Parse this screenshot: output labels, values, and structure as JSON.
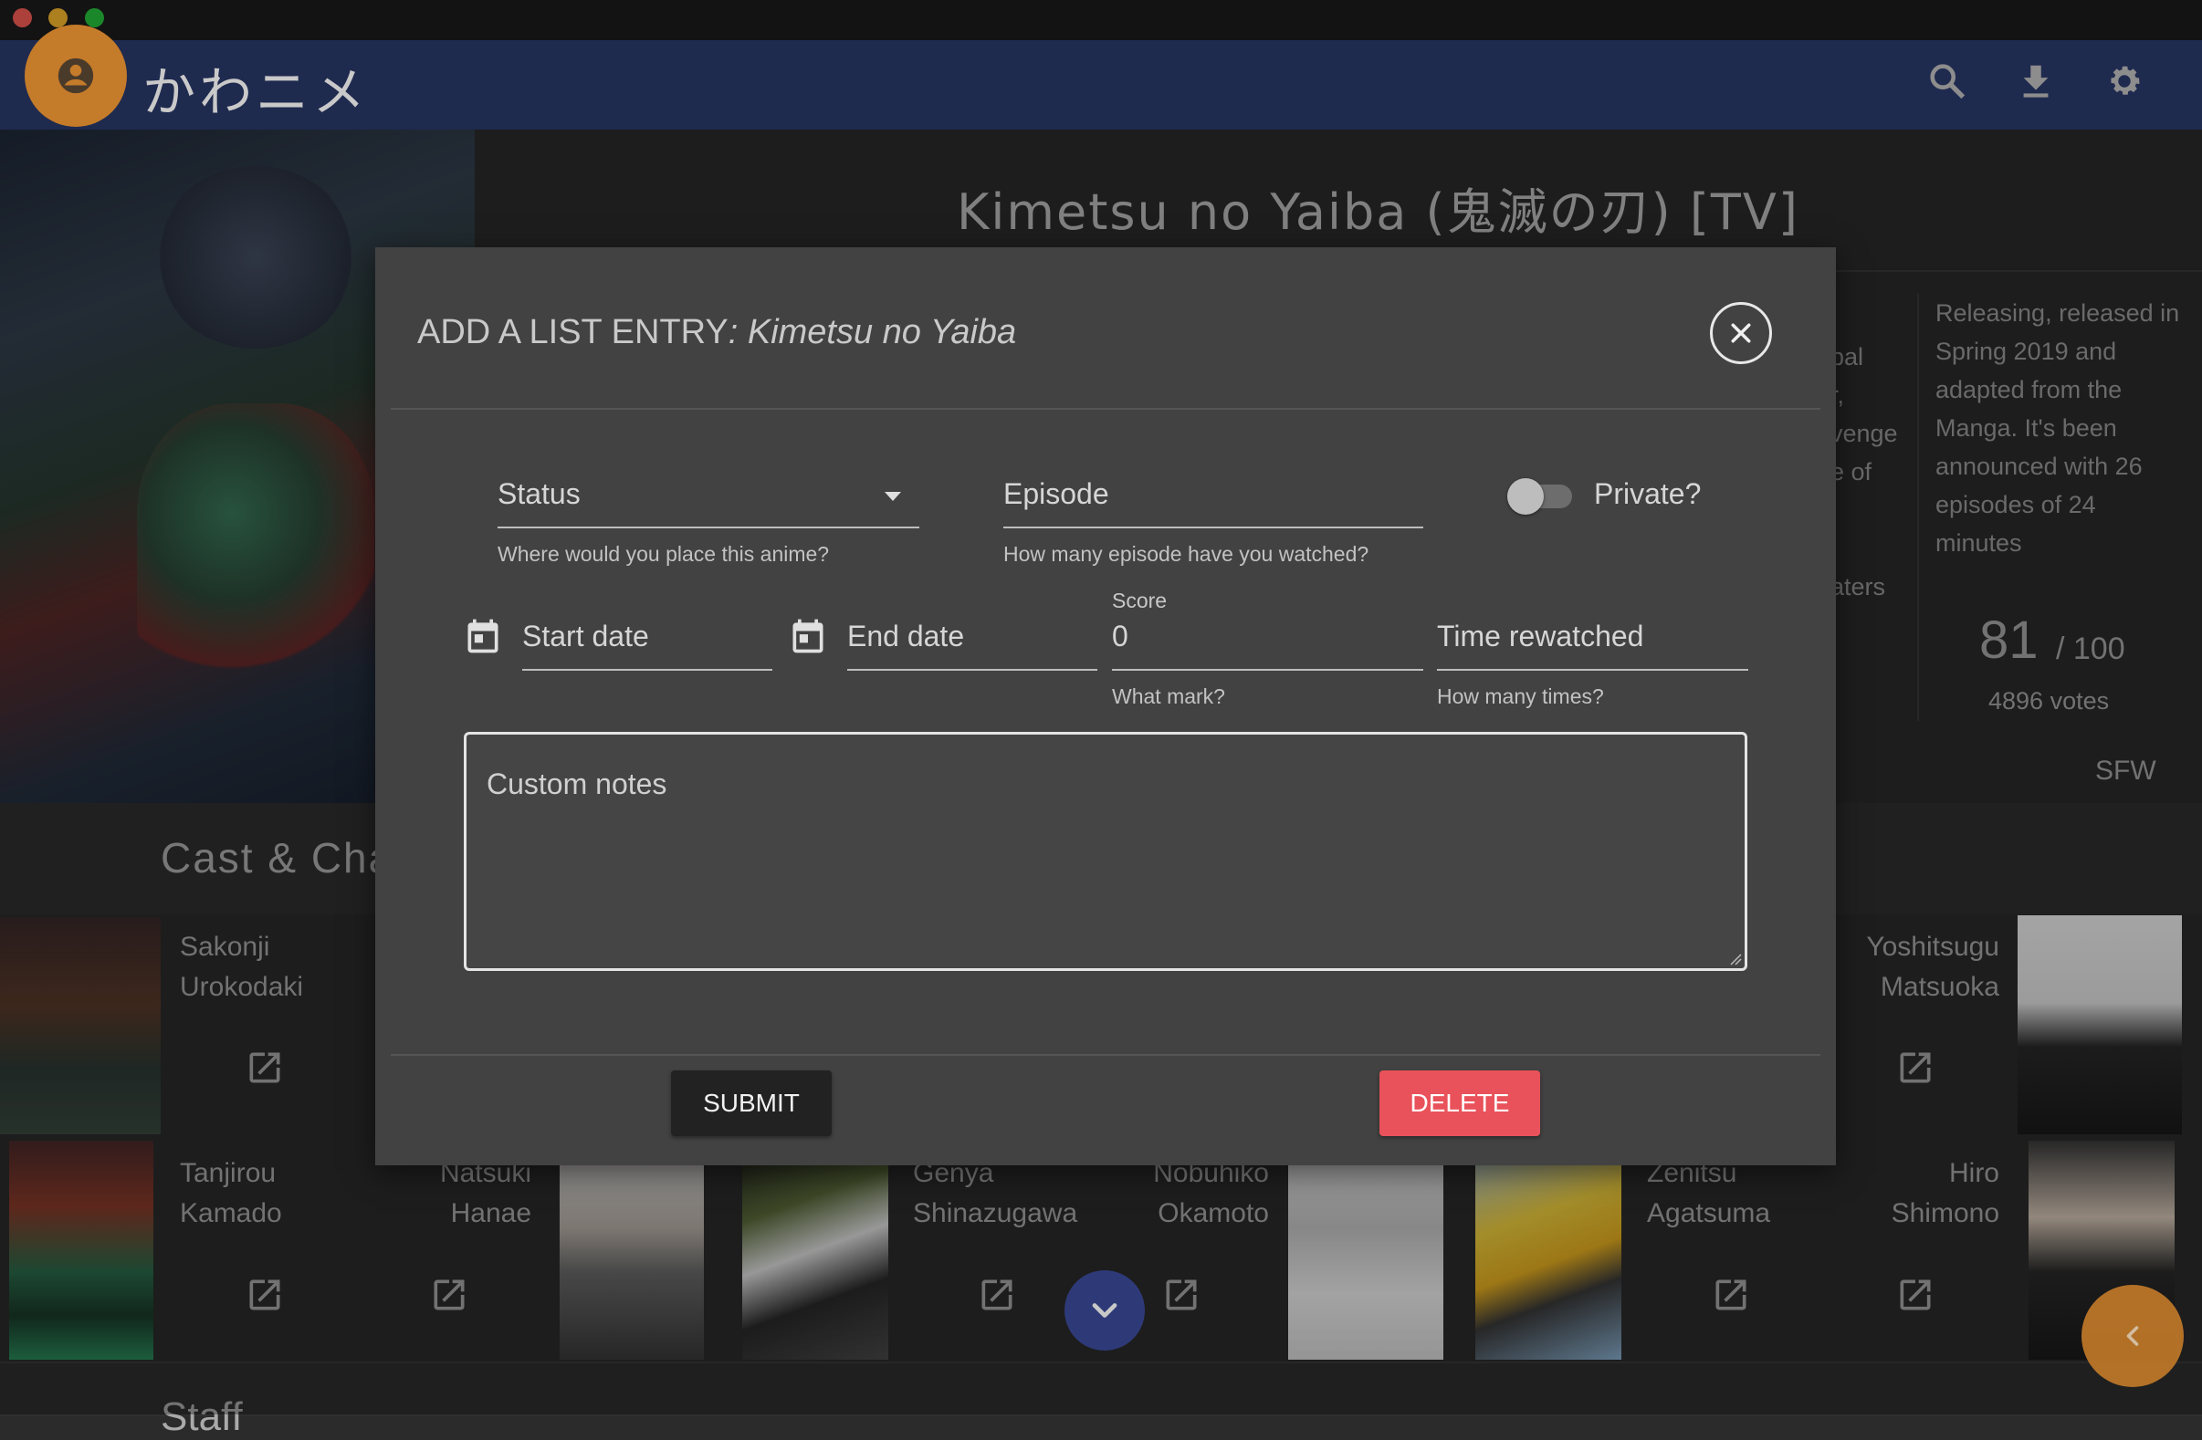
{
  "app": {
    "brand": "かわニメ",
    "accent": "#2e3e75",
    "orange": "#c47b2a"
  },
  "appbar": {
    "icons": [
      "search-icon",
      "download-icon",
      "settings-icon"
    ]
  },
  "anime": {
    "title": "Kimetsu no Yaiba (鬼滅の刃) [TV]",
    "synopsis_fragment": [
      "bal",
      "r,",
      "venge",
      "e of",
      "",
      "",
      "aters"
    ],
    "info": "Releasing, released in Spring 2019 and adapted from the Manga. It's been announced with 26 episodes of 24 minutes",
    "score": "81",
    "score_max": "/ 100",
    "votes": "4896 votes",
    "rating": "SFW"
  },
  "cast": {
    "heading": "Cast & Cha",
    "top_row": [
      {
        "name": "Sakonji Urokodaki"
      },
      {
        "name": "Yoshitsugu Matsuoka"
      }
    ],
    "bottom_row": [
      {
        "name": "Tanjirou Kamado"
      },
      {
        "name": "Natsuki Hanae"
      },
      {
        "name": "Genya Shinazugawa"
      },
      {
        "name": "Nobuhiko Okamoto"
      },
      {
        "name": "Zenitsu Agatsuma"
      },
      {
        "name": "Hiro Shimono"
      }
    ]
  },
  "staff": {
    "heading": "Staff"
  },
  "dialog": {
    "title_prefix": "ADD A LIST ENTRY",
    "title_anime": ": Kimetsu no Yaiba",
    "status": {
      "label": "Status",
      "hint": "Where would you place this anime?"
    },
    "episode": {
      "label": "Episode",
      "hint": "How many episode have you watched?"
    },
    "private": {
      "label": "Private?",
      "on": false
    },
    "start_date": {
      "label": "Start date"
    },
    "end_date": {
      "label": "End date"
    },
    "score": {
      "label": "Score",
      "value": "0",
      "hint": "What mark?"
    },
    "rewatched": {
      "label": "Time rewatched",
      "hint": "How many times?"
    },
    "notes": {
      "placeholder": "Custom notes"
    },
    "submit": "SUBMIT",
    "delete": "DELETE"
  }
}
